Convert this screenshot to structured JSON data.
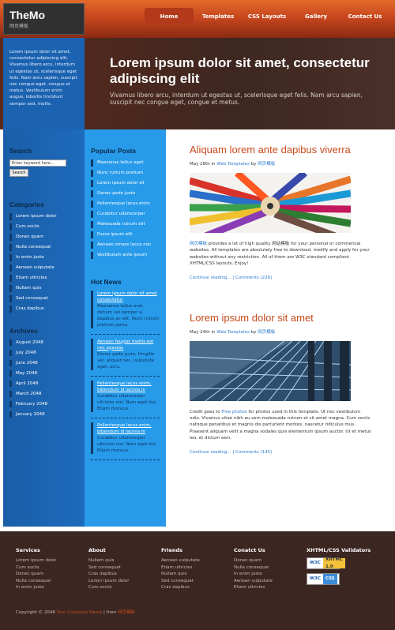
{
  "logo": {
    "title": "TheMo",
    "subtitle": "网页模板"
  },
  "nav": [
    "Home",
    "Templates",
    "CSS Layouts",
    "Gallery",
    "Contact Us"
  ],
  "hero": {
    "left_text": "Lorem ipsum dolor sit amet, consectetur adipiscing elit. Vivamus libero arcu, interdum ut egestas ut, scelerisque eget felis. Nam arcu sapien, suscipit nec congue eget, congue et metus. Vestibulum enim augue, lobortis tincidunt semper sed, mollis.",
    "title": "Lorem ipsum dolor sit amet, consectetur adipiscing elit",
    "subtitle": "Vivamus libero arcu, interdum ut egestas ut, scelerisque eget felis. Nam arcu sapien, suscipit nec congue eget, congue et metus."
  },
  "search": {
    "title": "Search",
    "placeholder": "Enter keyword here...",
    "button": "Search"
  },
  "categories": {
    "title": "Categories",
    "items": [
      "Lorem ipsum dolor",
      "Cum sociis",
      "Donec quam",
      "Nulla consequat",
      "In enim justo",
      "Aenean vulputate",
      "Etiam ultricies",
      "Nullam quis",
      "Sed consequat",
      "Cras dapibus"
    ]
  },
  "archives": {
    "title": "Archives",
    "items": [
      "August 2048",
      "July 2048",
      "June 2048",
      "May 2048",
      "April 2048",
      "March 2048",
      "February 2048",
      "January 2048"
    ]
  },
  "popular": {
    "title": "Popular Posts",
    "items": [
      "Maecenas tellus eget",
      "Nunc rutrum pretium",
      "Lorem ipsum dolor sit",
      "Donec pede justo",
      "Pellentesque lacus enim",
      "Curabitur ullamcorper",
      "Malesuada rutrum elit",
      "Fusce ipsum elit",
      "Aenean ornare lacus non",
      "Vestibulum ante ipsum"
    ]
  },
  "hotnews": {
    "title": "Hot News",
    "items": [
      {
        "head": "Lorem ipsum dolor sit amet consectetur",
        "body": "Maecenas tellus erat, dictum vel semper a, dapibus ac elit. Nunc rutrum pretium porta."
      },
      {
        "head": "Aenean feugiat mattis est nec egestas",
        "body": "Donec pede justo, fringilla vel, aliquet nec, vulputate eget, arcu."
      },
      {
        "head": "Pellentesque lacus enim, bibendum id lacinia in",
        "body": "Curabitur ullamcorper ultricies nisi. Nam eget dui. Etiam rhoncus."
      },
      {
        "head": "Pellentesque lacus enim, bibendum id lacinia in",
        "body": "Curabitur ullamcorper ultricies nisi. Nam eget dui. Etiam rhoncus."
      }
    ]
  },
  "posts": [
    {
      "title": "Aliquam lorem ante dapibus viverra",
      "date": "May 28th",
      "in_label": "in",
      "category": "Web Templates",
      "by_label": "by",
      "author": "网页模板",
      "body_link": "网页模板",
      "body": " provides a lot of high quality 网站模板 for your personal or commercial websites. All templates are absolutely free to download, modify and apply for your websites without any restriction. All of them are W3C standard compliant XHTML/CSS layouts. Enjoy!",
      "more": "Continue reading...",
      "sep": "|",
      "comments": "Comments (226)"
    },
    {
      "title": "Lorem ipsum dolor sit amet",
      "date": "May 24th",
      "in_label": "in",
      "category": "Web Templates",
      "by_label": "by",
      "author": "网页模板",
      "body_pre": "Credit goes to ",
      "body_link": "Free photos",
      "body": " for photos used in this template. Ut nec vestibulum odio. Vivamus vitae nibh eu sem malesuada rutrum et sit amet magna. Cum sociis natoque penatibus et magnis dis parturient montes, nascetur ridiculus mus. Praesent aliquam velit a magna sodales quis elementum ipsum auctor. Ut et metus leo, et dictum sem.",
      "more": "Continue reading...",
      "sep": "|",
      "comments": "Comments (145)"
    }
  ],
  "footer": {
    "cols": [
      {
        "title": "Services",
        "items": [
          "Lorem ipsum dolor",
          "Cum sociis",
          "Donec quam",
          "Nulla consequat",
          "In enim justo"
        ]
      },
      {
        "title": "About",
        "items": [
          "Nullam quis",
          "Sed consequat",
          "Cras dapibus",
          "Lorem ipsum dolor",
          "Cum sociis"
        ]
      },
      {
        "title": "Friends",
        "items": [
          "Aenean vulputate",
          "Etiam ultricies",
          "Nullam quis",
          "Sed consequat",
          "Cras dapibus"
        ]
      },
      {
        "title": "Conatct Us",
        "items": [
          "Donec quam",
          "Nulla consequat",
          "In enim justo",
          "Aenean vulputate",
          "Etiam ultricies"
        ]
      }
    ],
    "validators_title": "XHTML/CSS Validators",
    "badge1": {
      "w3c": "W3C",
      "label": "XHTML 1.0"
    },
    "badge2": {
      "w3c": "W3C",
      "label": "CSS"
    },
    "copyright": "Copyright © 2048",
    "company": "Your Company Name",
    "from_label": "| from",
    "from_link": "网页模板"
  },
  "colors": {
    "accent_orange": "#c84a1c",
    "sidebar_dark": "#1a5ea8",
    "sidebar_light": "#279bea",
    "footer_bg": "#3b2621"
  }
}
